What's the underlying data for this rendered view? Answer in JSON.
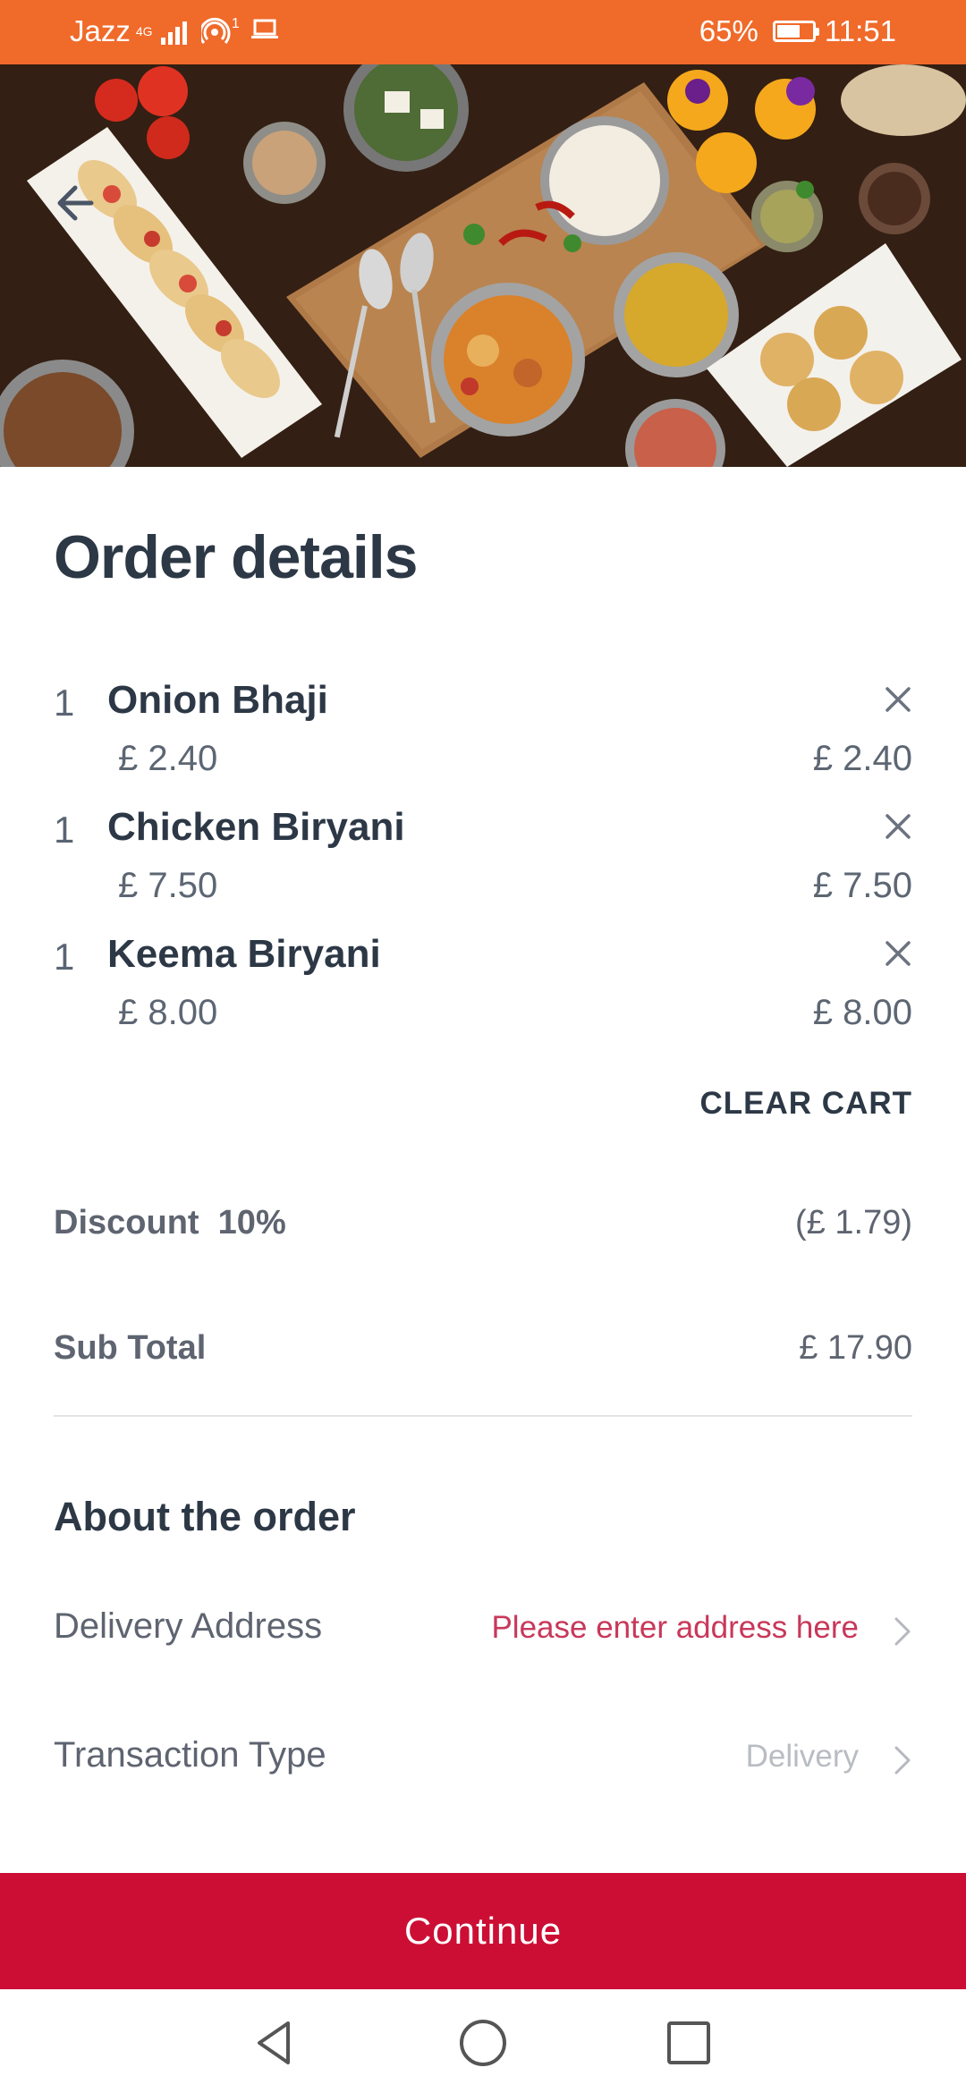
{
  "status_bar": {
    "carrier": "Jazz",
    "network_type": "4G",
    "hotspot_count": "1",
    "battery_percent": "65%",
    "battery_level": 0.65,
    "time": "11:51"
  },
  "hero": {
    "image_icon": "food-spread-photo",
    "back_icon": "arrow-left-icon"
  },
  "page": {
    "title": "Order details"
  },
  "order_items": [
    {
      "qty": "1",
      "name": "Onion Bhaji",
      "unit_price": "£ 2.40",
      "total_price": "£ 2.40"
    },
    {
      "qty": "1",
      "name": "Chicken Biryani",
      "unit_price": "£ 7.50",
      "total_price": "£ 7.50"
    },
    {
      "qty": "1",
      "name": "Keema Biryani",
      "unit_price": "£ 8.00",
      "total_price": "£ 8.00"
    }
  ],
  "actions": {
    "clear_cart": "CLEAR CART",
    "continue": "Continue"
  },
  "summary": {
    "discount_label": "Discount  10%",
    "discount_value": "(£ 1.79)",
    "subtotal_label": "Sub Total",
    "subtotal_value": "£ 17.90"
  },
  "about": {
    "title": "About the order",
    "delivery_address_label": "Delivery Address",
    "delivery_address_value": "Please enter address here",
    "transaction_type_label": "Transaction Type",
    "transaction_type_value": "Delivery"
  },
  "colors": {
    "status_bar": "#f06a2a",
    "accent": "#cc0e35",
    "address_prompt": "#c8385a",
    "text_dark": "#2d3846",
    "placeholder": "#b9bcc2"
  },
  "nav": {
    "back_icon": "triangle-back-icon",
    "home_icon": "circle-home-icon",
    "recents_icon": "square-recents-icon"
  }
}
